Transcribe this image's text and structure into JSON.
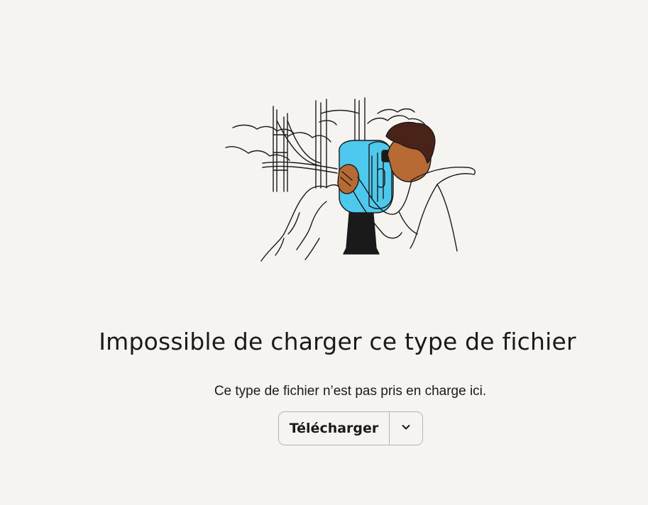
{
  "error": {
    "title": "Impossible de charger ce type de fichier",
    "message": "Ce type de fichier n’est pas pris en charge ici."
  },
  "actions": {
    "download_label": "Télécharger",
    "more_icon": "chevron-down-icon"
  },
  "colors": {
    "background": "#f6f4f0",
    "text": "#1e1919",
    "accent_blue": "#4ec8ec",
    "skin": "#b86a35",
    "hair": "#4a2318"
  }
}
